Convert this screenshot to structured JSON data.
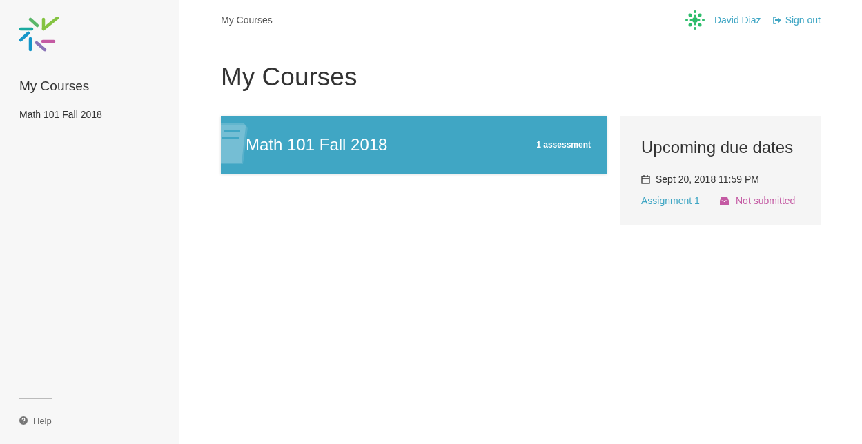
{
  "sidebar": {
    "heading": "My Courses",
    "items": [
      {
        "label": "Math 101 Fall 2018"
      }
    ],
    "help": "Help"
  },
  "breadcrumb": "My Courses",
  "user": {
    "name": "David Diaz",
    "sign_out": "Sign out"
  },
  "page_title": "My Courses",
  "courses": [
    {
      "title": "Math 101 Fall 2018",
      "count": "1 assessment"
    }
  ],
  "upcoming": {
    "title": "Upcoming due dates",
    "items": [
      {
        "date": "Sept 20, 2018 11:59 PM",
        "assignment": "Assignment 1",
        "status": "Not submitted"
      }
    ]
  }
}
